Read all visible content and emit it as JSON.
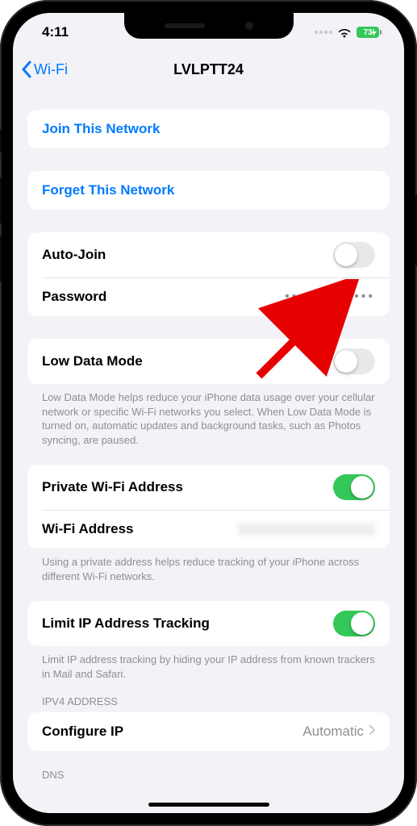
{
  "status": {
    "time": "4:11",
    "battery": "73"
  },
  "nav": {
    "back": "Wi-Fi",
    "title": "LVLPTT24"
  },
  "actions": {
    "join": "Join This Network",
    "forget": "Forget This Network"
  },
  "auto_join": {
    "label": "Auto-Join",
    "on": false
  },
  "password": {
    "label": "Password",
    "value": "•••••••••••••"
  },
  "low_data": {
    "label": "Low Data Mode",
    "on": false,
    "footer": "Low Data Mode helps reduce your iPhone data usage over your cellular network or specific Wi-Fi networks you select. When Low Data Mode is turned on, automatic updates and background tasks, such as Photos syncing, are paused."
  },
  "private_addr": {
    "label": "Private Wi-Fi Address",
    "on": true
  },
  "wifi_addr": {
    "label": "Wi-Fi Address",
    "footer": "Using a private address helps reduce tracking of your iPhone across different Wi-Fi networks."
  },
  "limit_ip": {
    "label": "Limit IP Address Tracking",
    "on": true,
    "footer": "Limit IP address tracking by hiding your IP address from known trackers in Mail and Safari."
  },
  "ipv4": {
    "header": "IPV4 ADDRESS",
    "configure_label": "Configure IP",
    "configure_value": "Automatic"
  },
  "dns": {
    "header": "DNS"
  }
}
